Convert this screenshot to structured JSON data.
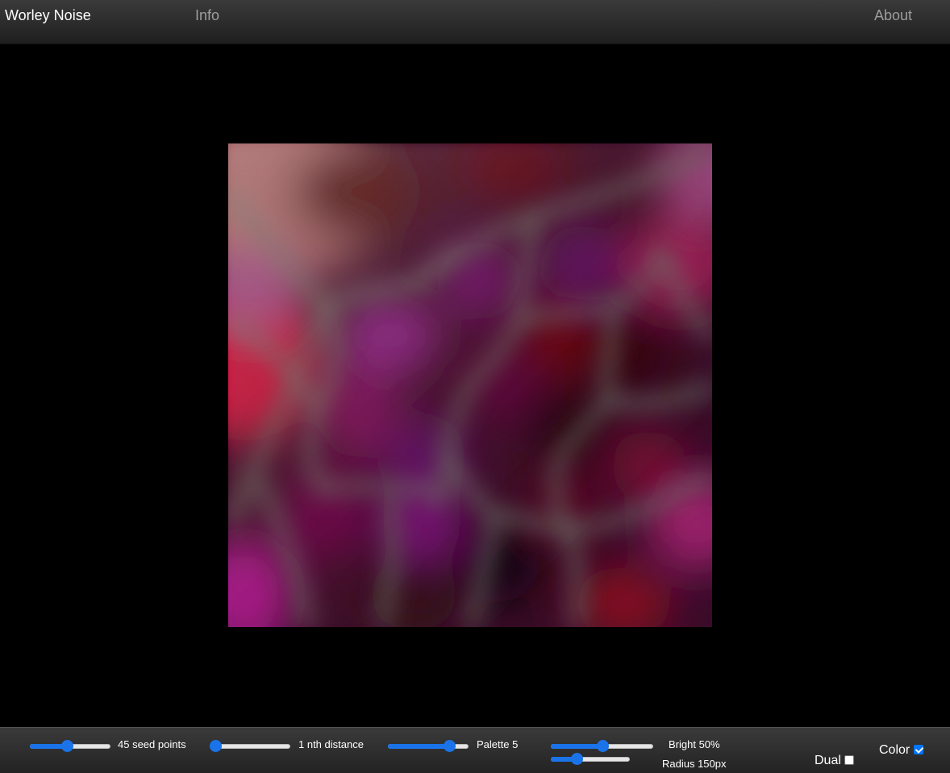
{
  "header": {
    "brand": "Worley Noise",
    "nav": {
      "info": "Info",
      "about": "About"
    }
  },
  "controls": {
    "seed_points": {
      "label": "45 seed points",
      "value": 0.45
    },
    "nth_distance": {
      "label": "1 nth distance",
      "value": 0.0
    },
    "palette": {
      "label": "Palette 5",
      "value": 0.8
    },
    "brightness": {
      "label": "Bright 50%",
      "value": 0.5
    },
    "radius": {
      "label": "Radius 150px",
      "value": 0.3
    },
    "dual": {
      "label": "Dual",
      "checked": false
    },
    "color": {
      "label": "Color",
      "checked": true
    }
  },
  "colors": {
    "accent": "#1a73e8",
    "checkbox_checked": "#0075ff",
    "nav_text": "#9d9d9d"
  }
}
